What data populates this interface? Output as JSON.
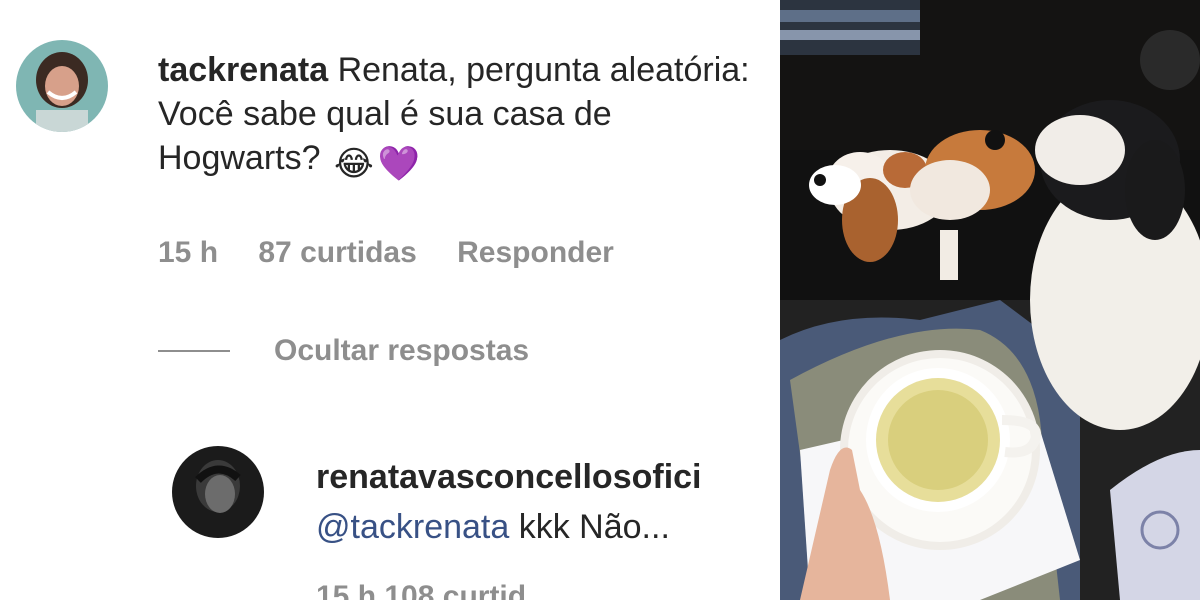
{
  "comment": {
    "username": "tackrenata",
    "text": "Renata, pergunta aleatória: Você sabe qual é sua casa de Hogwarts?",
    "emojis": [
      "😂",
      "💜"
    ],
    "time": "15 h",
    "likes": "87 curtidas",
    "reply_label": "Responder"
  },
  "hide_replies_label": "Ocultar respostas",
  "reply": {
    "username": "renatavasconcellosofici",
    "mention": "@tackrenata",
    "text": "kkk Não...",
    "meta_partial": "15 h   108 curtid"
  },
  "photo": {
    "description_icon": "photo-dogs-tea"
  },
  "colors": {
    "text": "#262626",
    "muted": "#8e8e8e",
    "mention": "#385185"
  }
}
